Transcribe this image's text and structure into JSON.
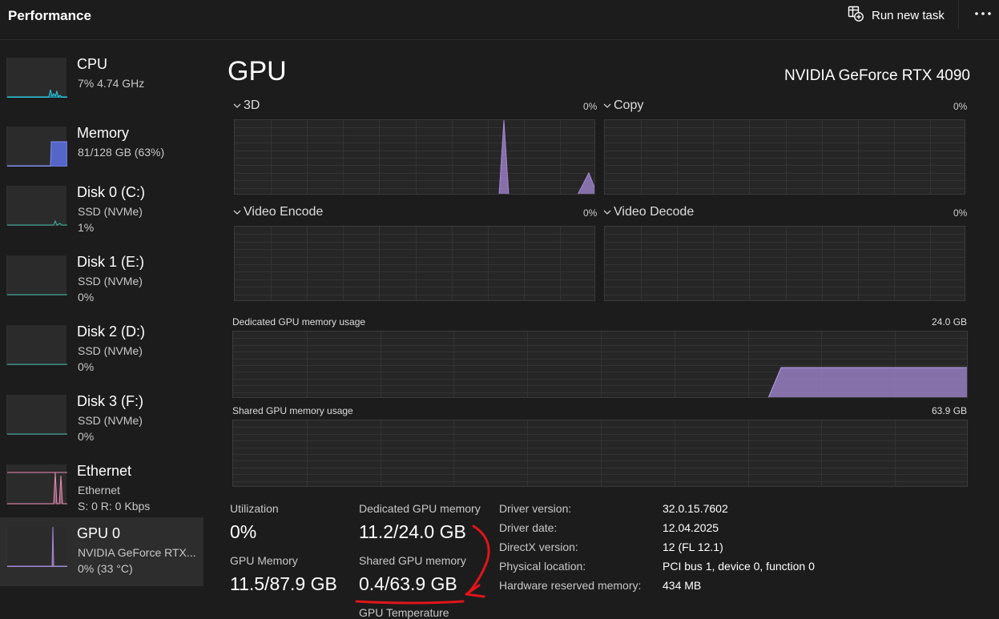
{
  "header": {
    "title": "Performance",
    "run_new_task": "Run new task",
    "more_icon": "more-dots-icon",
    "run_task_icon": "run-task-icon"
  },
  "sidebar": {
    "items": [
      {
        "name": "CPU",
        "line1": "7% 4.74 GHz",
        "line2": "",
        "color": "#2dc7e0"
      },
      {
        "name": "Memory",
        "line1": "81/128 GB (63%)",
        "line2": "",
        "color": "#6d7fe8"
      },
      {
        "name": "Disk 0 (C:)",
        "line1": "SSD (NVMe)",
        "line2": "1%",
        "color": "#3fb8a5"
      },
      {
        "name": "Disk 1 (E:)",
        "line1": "SSD (NVMe)",
        "line2": "0%",
        "color": "#3fb8a5"
      },
      {
        "name": "Disk 2 (D:)",
        "line1": "SSD (NVMe)",
        "line2": "0%",
        "color": "#3fb8a5"
      },
      {
        "name": "Disk 3 (F:)",
        "line1": "SSD (NVMe)",
        "line2": "0%",
        "color": "#3fb8a5"
      },
      {
        "name": "Ethernet",
        "line1": "Ethernet",
        "line2": "S: 0 R: 0 Kbps",
        "color": "#e88bb5"
      },
      {
        "name": "GPU 0",
        "line1": "NVIDIA GeForce RTX...",
        "line2": "0%  (33 °C)",
        "color": "#a689d6"
      }
    ],
    "selected": "GPU 0"
  },
  "main": {
    "title": "GPU",
    "model": "NVIDIA GeForce RTX 4090",
    "engines": [
      {
        "label": "3D",
        "pct": "0%"
      },
      {
        "label": "Copy",
        "pct": "0%"
      },
      {
        "label": "Video Encode",
        "pct": "0%"
      },
      {
        "label": "Video Decode",
        "pct": "0%"
      }
    ],
    "dedicated_graph": {
      "label": "Dedicated GPU memory usage",
      "max": "24.0 GB"
    },
    "shared_graph": {
      "label": "Shared GPU memory usage",
      "max": "63.9 GB"
    },
    "accent_color": "#a689d6"
  },
  "stats": {
    "utilization_label": "Utilization",
    "utilization_value": "0%",
    "gpu_memory_label": "GPU Memory",
    "gpu_memory_value": "11.5/87.9 GB",
    "dedicated_label": "Dedicated GPU memory",
    "dedicated_value": "11.2/24.0 GB",
    "shared_label": "Shared GPU memory",
    "shared_value": "0.4/63.9 GB",
    "temperature_label": "GPU Temperature"
  },
  "properties": [
    {
      "key": "Driver version:",
      "value": "32.0.15.7602"
    },
    {
      "key": "Driver date:",
      "value": "12.04.2025"
    },
    {
      "key": "DirectX version:",
      "value": "12 (FL 12.1)"
    },
    {
      "key": "Physical location:",
      "value": "PCI bus 1, device 0, function 0"
    },
    {
      "key": "Hardware reserved memory:",
      "value": "434 MB"
    }
  ],
  "annotation_color": "#e0151b"
}
